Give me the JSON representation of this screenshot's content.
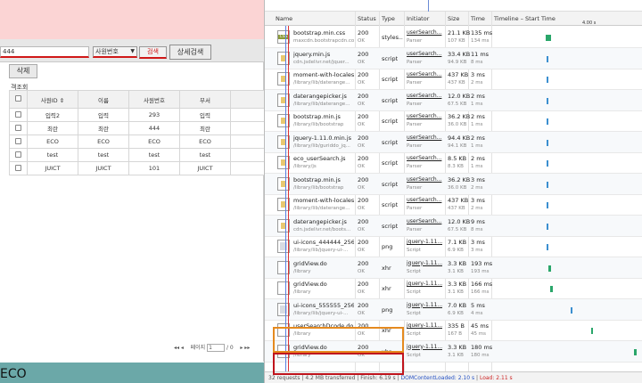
{
  "app": {
    "search_value": "444",
    "search_type": "사원번호",
    "search_button": "검색",
    "detail_button": "상세검색",
    "delete_button": "삭제",
    "grid_caption": "객조회",
    "columns": [
      "사원ID ⇕",
      "이름",
      "사원번호",
      "부서"
    ],
    "rows": [
      [
        "입력2",
        "입력",
        "293",
        "입력"
      ],
      [
        "최란",
        "최란",
        "444",
        "최란"
      ],
      [
        "ECO",
        "ECO",
        "ECO",
        "ECO"
      ],
      [
        "test",
        "test",
        "test",
        "test"
      ],
      [
        "JUICT",
        "JUICT",
        "101",
        "JUICT"
      ]
    ],
    "pager": {
      "nav_left": "◂◂  ◂",
      "page_label": "페이지",
      "page_value": "1",
      "page_total": "/ 0",
      "nav_right": "▸  ▸▸"
    },
    "bottom_text": "ECO"
  },
  "network": {
    "timeline_tick": "4.00 s",
    "headers": {
      "name": "Name",
      "status": "Status",
      "type": "Type",
      "initiator": "Initiator",
      "size": "Size",
      "time": "Time",
      "timeline": "Timeline – Start Time",
      "tick": "4.00 s"
    },
    "requests": [
      {
        "name": "bootstrap.min.css",
        "path": "maxcdn.bootstrapcdn.com",
        "status": "200",
        "status_text": "OK",
        "type": "styles...",
        "initiator": "userSearch...",
        "initiator_sub": "Parser",
        "size": "21.1 KB",
        "content": "107 KB",
        "time": "135 ms",
        "latency": "134 ms",
        "icon": "css",
        "wf_start": 0.35,
        "wf_end": 0.39,
        "wf_color": "#2aa66a"
      },
      {
        "name": "jquery.min.js",
        "path": "cdn.jsdelivr.net/jquer...",
        "status": "200",
        "status_text": "OK",
        "type": "script",
        "initiator": "userSearch...",
        "initiator_sub": "Parser",
        "size": "33.4 KB",
        "content": "94.9 KB",
        "time": "11 ms",
        "latency": "8 ms",
        "icon": "js",
        "wf_start": 0.36,
        "wf_end": 0.37,
        "wf_color": "#3b8fd0"
      },
      {
        "name": "moment-with-locales.js",
        "path": "/library/lib/daterange...",
        "status": "200",
        "status_text": "OK",
        "type": "script",
        "initiator": "userSearch...",
        "initiator_sub": "Parser",
        "size": "437 KB",
        "content": "437 KB",
        "time": "3 ms",
        "latency": "2 ms",
        "icon": "js",
        "wf_start": 0.36,
        "wf_end": 0.37,
        "wf_color": "#3b8fd0"
      },
      {
        "name": "daterangepicker.js",
        "path": "/library/lib/daterange...",
        "status": "200",
        "status_text": "OK",
        "type": "script",
        "initiator": "userSearch...",
        "initiator_sub": "Parser",
        "size": "12.0 KB",
        "content": "67.5 KB",
        "time": "2 ms",
        "latency": "1 ms",
        "icon": "js",
        "wf_start": 0.36,
        "wf_end": 0.37,
        "wf_color": "#3b8fd0"
      },
      {
        "name": "bootstrap.min.js",
        "path": "/library/lib/bootstrap",
        "status": "200",
        "status_text": "OK",
        "type": "script",
        "initiator": "userSearch...",
        "initiator_sub": "Parser",
        "size": "36.2 KB",
        "content": "36.0 KB",
        "time": "2 ms",
        "latency": "1 ms",
        "icon": "js",
        "wf_start": 0.36,
        "wf_end": 0.37,
        "wf_color": "#3b8fd0"
      },
      {
        "name": "jquery-1.11.0.min.js",
        "path": "/library/lib/guriddo_jq...",
        "status": "200",
        "status_text": "OK",
        "type": "script",
        "initiator": "userSearch...",
        "initiator_sub": "Parser",
        "size": "94.4 KB",
        "content": "94.1 KB",
        "time": "2 ms",
        "latency": "1 ms",
        "icon": "js",
        "wf_start": 0.36,
        "wf_end": 0.37,
        "wf_color": "#3b8fd0"
      },
      {
        "name": "eco_userSearch.js",
        "path": "/library/js",
        "status": "200",
        "status_text": "OK",
        "type": "script",
        "initiator": "userSearch...",
        "initiator_sub": "Parser",
        "size": "8.5 KB",
        "content": "8.3 KB",
        "time": "2 ms",
        "latency": "1 ms",
        "icon": "js",
        "wf_start": 0.36,
        "wf_end": 0.37,
        "wf_color": "#3b8fd0"
      },
      {
        "name": "bootstrap.min.js",
        "path": "/library/lib/bootstrap",
        "status": "200",
        "status_text": "OK",
        "type": "script",
        "initiator": "userSearch...",
        "initiator_sub": "Parser",
        "size": "36.2 KB",
        "content": "36.0 KB",
        "time": "3 ms",
        "latency": "2 ms",
        "icon": "js",
        "wf_start": 0.36,
        "wf_end": 0.37,
        "wf_color": "#3b8fd0"
      },
      {
        "name": "moment-with-locales.js",
        "path": "/library/lib/daterange...",
        "status": "200",
        "status_text": "OK",
        "type": "script",
        "initiator": "userSearch...",
        "initiator_sub": "Parser",
        "size": "437 KB",
        "content": "437 KB",
        "time": "3 ms",
        "latency": "2 ms",
        "icon": "js",
        "wf_start": 0.36,
        "wf_end": 0.37,
        "wf_color": "#3b8fd0"
      },
      {
        "name": "daterangepicker.js",
        "path": "cdn.jsdelivr.net/boots...",
        "status": "200",
        "status_text": "OK",
        "type": "script",
        "initiator": "userSearch...",
        "initiator_sub": "Parser",
        "size": "12.0 KB",
        "content": "67.5 KB",
        "time": "9 ms",
        "latency": "8 ms",
        "icon": "js",
        "wf_start": 0.36,
        "wf_end": 0.37,
        "wf_color": "#3b8fd0"
      },
      {
        "name": "ui-icons_444444_256x...",
        "path": "/library/lib/jquery-ui-...",
        "status": "200",
        "status_text": "OK",
        "type": "png",
        "initiator": "jquery-1.11...",
        "initiator_sub": "Script",
        "size": "7.1 KB",
        "content": "6.9 KB",
        "time": "3 ms",
        "latency": "3 ms",
        "icon": "img",
        "wf_start": 0.36,
        "wf_end": 0.37,
        "wf_color": "#3b8fd0"
      },
      {
        "name": "gridView.do",
        "path": "/library",
        "status": "200",
        "status_text": "OK",
        "type": "xhr",
        "initiator": "jquery-1.11...",
        "initiator_sub": "Script",
        "size": "3.3 KB",
        "content": "3.1 KB",
        "time": "193 ms",
        "latency": "193 ms",
        "icon": "doc",
        "wf_start": 0.37,
        "wf_end": 0.39,
        "wf_color": "#2aa66a"
      },
      {
        "name": "gridView.do",
        "path": "/library",
        "status": "200",
        "status_text": "OK",
        "type": "xhr",
        "initiator": "jquery-1.11...",
        "initiator_sub": "Script",
        "size": "3.3 KB",
        "content": "3.1 KB",
        "time": "166 ms",
        "latency": "166 ms",
        "icon": "doc",
        "wf_start": 0.38,
        "wf_end": 0.4,
        "wf_color": "#2aa66a"
      },
      {
        "name": "ui-icons_555555_256x...",
        "path": "/library/lib/jquery-ui-...",
        "status": "200",
        "status_text": "OK",
        "type": "png",
        "initiator": "jquery-1.11...",
        "initiator_sub": "Script",
        "size": "7.0 KB",
        "content": "6.9 KB",
        "time": "5 ms",
        "latency": "4 ms",
        "icon": "img",
        "wf_start": 0.52,
        "wf_end": 0.53,
        "wf_color": "#3b8fd0"
      },
      {
        "name": "userSearchDcode.do",
        "path": "/library",
        "status": "200",
        "status_text": "OK",
        "type": "xhr",
        "initiator": "jquery-1.11...",
        "initiator_sub": "Script",
        "size": "335 B",
        "content": "167 B",
        "time": "45 ms",
        "latency": "45 ms",
        "icon": "doc",
        "wf_start": 0.66,
        "wf_end": 0.67,
        "wf_color": "#2aa66a"
      },
      {
        "name": "gridView.do",
        "path": "/library",
        "status": "200",
        "status_text": "OK",
        "type": "xhr",
        "initiator": "jquery-1.11...",
        "initiator_sub": "Script",
        "size": "3.3 KB",
        "content": "3.1 KB",
        "time": "180 ms",
        "latency": "180 ms",
        "icon": "doc",
        "wf_start": 0.95,
        "wf_end": 0.97,
        "wf_color": "#2aa66a"
      }
    ],
    "footer": {
      "requests": "32 requests",
      "transferred": "4.2 MB transferred",
      "finish": "Finish: 6.19 s",
      "dcl": "DOMContentLoaded: 2.10 s",
      "load": "Load: 2.11 s"
    }
  }
}
